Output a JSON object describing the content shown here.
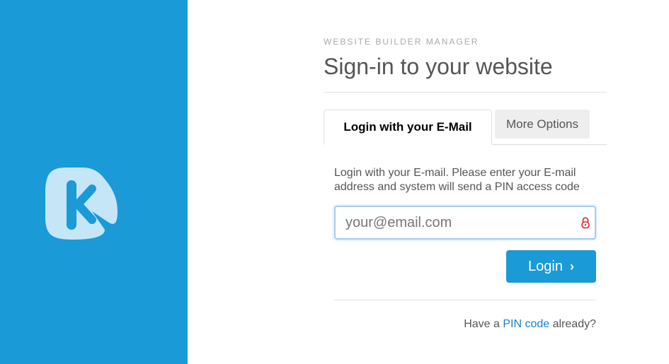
{
  "branding": {
    "logo_icon": "k-logo-icon",
    "panel_color": "#1a9ad6",
    "logo_color": "#c5e6f6"
  },
  "header": {
    "eyebrow": "WEBSITE BUILDER MANAGER",
    "title": "Sign-in to your website"
  },
  "tabs": [
    {
      "label": "Login with your E-Mail",
      "active": true
    },
    {
      "label": "More Options",
      "active": false
    }
  ],
  "form": {
    "help_text": "Login with your E-mail. Please enter your E-mail address and system will send a PIN access code",
    "email_placeholder": "your@email.com",
    "email_value": "",
    "lock_icon": "lock-icon",
    "login_label": "Login",
    "login_icon": "chevron-right-icon"
  },
  "footer": {
    "pin_prefix": "Have a",
    "pin_link": "PIN code",
    "pin_suffix": "already?"
  },
  "colors": {
    "accent": "#1a9ad6",
    "link": "#1a7fcb",
    "lock": "#e0202e"
  }
}
